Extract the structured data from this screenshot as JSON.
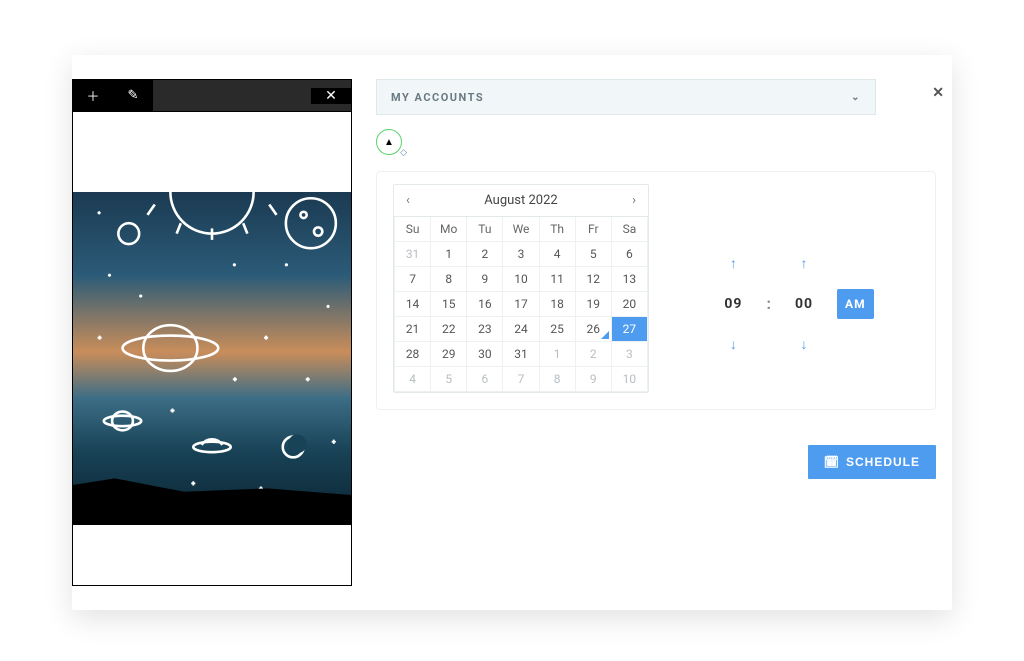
{
  "preview_toolbar": {
    "add_icon": "＋",
    "edit_icon": "✎",
    "close_icon": "✕"
  },
  "modal_close_icon": "✕",
  "accounts": {
    "label": "MY ACCOUNTS",
    "chevron": "⌄"
  },
  "avatar": {
    "glyph": "▲",
    "badge": "◇"
  },
  "calendar": {
    "prev_icon": "‹",
    "next_icon": "›",
    "title": "August 2022",
    "dow": [
      "Su",
      "Mo",
      "Tu",
      "We",
      "Th",
      "Fr",
      "Sa"
    ],
    "weeks": [
      [
        {
          "d": "31",
          "dim": true
        },
        {
          "d": "1"
        },
        {
          "d": "2"
        },
        {
          "d": "3"
        },
        {
          "d": "4"
        },
        {
          "d": "5"
        },
        {
          "d": "6"
        }
      ],
      [
        {
          "d": "7"
        },
        {
          "d": "8"
        },
        {
          "d": "9"
        },
        {
          "d": "10"
        },
        {
          "d": "11"
        },
        {
          "d": "12"
        },
        {
          "d": "13"
        }
      ],
      [
        {
          "d": "14"
        },
        {
          "d": "15"
        },
        {
          "d": "16"
        },
        {
          "d": "17"
        },
        {
          "d": "18"
        },
        {
          "d": "19"
        },
        {
          "d": "20"
        }
      ],
      [
        {
          "d": "21"
        },
        {
          "d": "22"
        },
        {
          "d": "23"
        },
        {
          "d": "24"
        },
        {
          "d": "25"
        },
        {
          "d": "26",
          "today": true
        },
        {
          "d": "27",
          "sel": true
        }
      ],
      [
        {
          "d": "28"
        },
        {
          "d": "29"
        },
        {
          "d": "30"
        },
        {
          "d": "31"
        },
        {
          "d": "1",
          "dim": true
        },
        {
          "d": "2",
          "dim": true
        },
        {
          "d": "3",
          "dim": true
        }
      ],
      [
        {
          "d": "4",
          "dim": true
        },
        {
          "d": "5",
          "dim": true
        },
        {
          "d": "6",
          "dim": true
        },
        {
          "d": "7",
          "dim": true
        },
        {
          "d": "8",
          "dim": true
        },
        {
          "d": "9",
          "dim": true
        },
        {
          "d": "10",
          "dim": true
        }
      ]
    ]
  },
  "time": {
    "up_icon": "↑",
    "down_icon": "↓",
    "hour": "09",
    "colon": ":",
    "minute": "00",
    "ampm": "AM"
  },
  "schedule": {
    "icon": "🗓",
    "label": "SCHEDULE"
  }
}
